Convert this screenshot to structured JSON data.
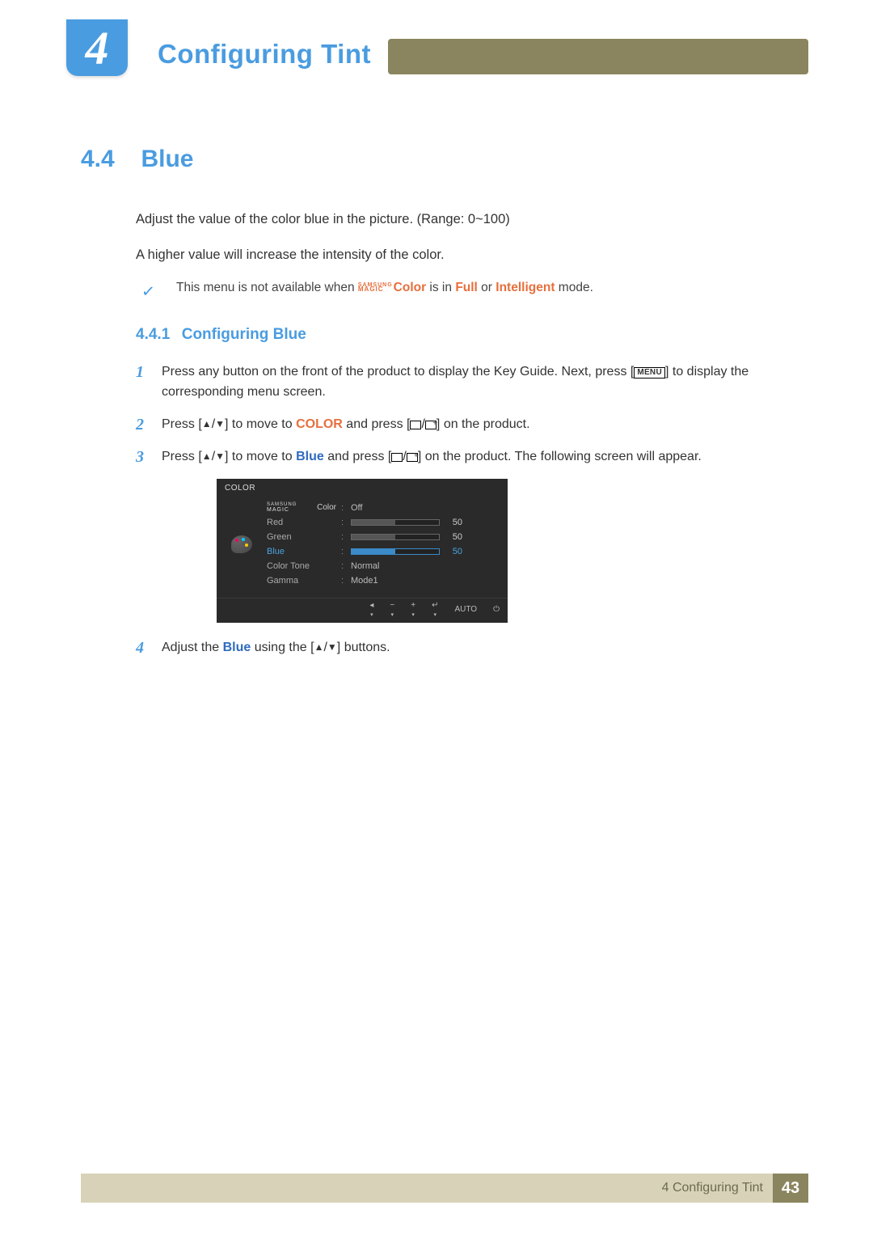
{
  "header": {
    "chapter_number": "4",
    "chapter_title": "Configuring Tint"
  },
  "section": {
    "number": "4.4",
    "title": "Blue",
    "intro_paragraphs": [
      "Adjust the value of the color blue in the picture. (Range: 0~100)",
      "A higher value will increase the intensity of the color."
    ],
    "note": {
      "pre": "This menu is not available when ",
      "brand_top": "SAMSUNG",
      "brand_bottom": "MAGIC",
      "brand_suffix": "Color",
      "mid1": " is in ",
      "full": "Full",
      "mid2": " or ",
      "intelligent": "Intelligent",
      "post": " mode."
    },
    "subsection": {
      "number": "4.4.1",
      "title": "Configuring Blue"
    },
    "steps": [
      {
        "n": "1",
        "parts": [
          {
            "t": "Press any button on the front of the product to display the Key Guide. Next, press ["
          },
          {
            "menu": "MENU"
          },
          {
            "t": "] to display the corresponding menu screen."
          }
        ]
      },
      {
        "n": "2",
        "parts": [
          {
            "t": "Press ["
          },
          {
            "tri": "▲"
          },
          {
            "t": "/"
          },
          {
            "tri": "▼"
          },
          {
            "t": "] to move to "
          },
          {
            "orange": "COLOR"
          },
          {
            "t": " and press ["
          },
          {
            "rect": ""
          },
          {
            "t": "/"
          },
          {
            "rectp": ""
          },
          {
            "t": "] on the product."
          }
        ]
      },
      {
        "n": "3",
        "parts": [
          {
            "t": "Press ["
          },
          {
            "tri": "▲"
          },
          {
            "t": "/"
          },
          {
            "tri": "▼"
          },
          {
            "t": "] to move to "
          },
          {
            "blue": "Blue"
          },
          {
            "t": " and press ["
          },
          {
            "rect": ""
          },
          {
            "t": "/"
          },
          {
            "rectp": ""
          },
          {
            "t": "] on the product. The following screen will appear."
          }
        ]
      },
      {
        "n": "4",
        "parts": [
          {
            "t": "Adjust the "
          },
          {
            "blue": "Blue"
          },
          {
            "t": " using the ["
          },
          {
            "tri": "▲"
          },
          {
            "t": "/"
          },
          {
            "tri": "▼"
          },
          {
            "t": "] buttons."
          }
        ]
      }
    ]
  },
  "osd": {
    "title": "COLOR",
    "rows": [
      {
        "kind": "samsung",
        "label_top": "SAMSUNG",
        "label_bot": "MAGIC",
        "label_suffix": " Color",
        "value": "Off"
      },
      {
        "kind": "slider",
        "label": "Red",
        "value": 50,
        "hl": false
      },
      {
        "kind": "slider",
        "label": "Green",
        "value": 50,
        "hl": false
      },
      {
        "kind": "slider",
        "label": "Blue",
        "value": 50,
        "hl": true
      },
      {
        "kind": "text",
        "label": "Color Tone",
        "value": "Normal"
      },
      {
        "kind": "text",
        "label": "Gamma",
        "value": "Mode1"
      }
    ],
    "footer_icons": [
      {
        "sym": "◂",
        "dn": "▾"
      },
      {
        "sym": "−",
        "dn": "▾"
      },
      {
        "sym": "+",
        "dn": "▾"
      },
      {
        "sym": "↵",
        "dn": "▾"
      },
      {
        "sym": "AUTO",
        "dn": ""
      },
      {
        "sym": "⏻",
        "dn": ""
      }
    ]
  },
  "footer": {
    "text": "4 Configuring Tint",
    "page": "43"
  }
}
